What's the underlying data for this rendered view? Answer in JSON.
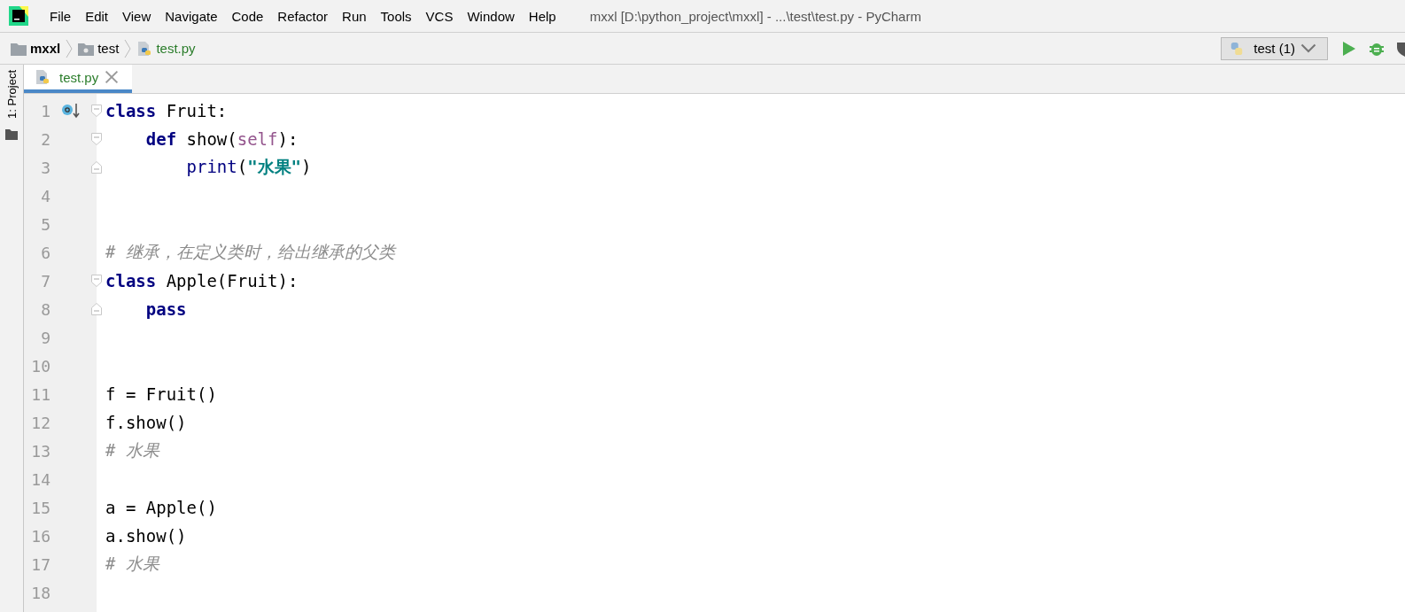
{
  "menu": [
    "File",
    "Edit",
    "View",
    "Navigate",
    "Code",
    "Refactor",
    "Run",
    "Tools",
    "VCS",
    "Window",
    "Help"
  ],
  "window": {
    "title": "mxxl [D:\\python_project\\mxxl] - ...\\test\\test.py - PyCharm"
  },
  "breadcrumbs": [
    {
      "kind": "project",
      "label": "mxxl"
    },
    {
      "kind": "folder",
      "label": "test"
    },
    {
      "kind": "file",
      "label": "test.py"
    }
  ],
  "run_config": {
    "label": "test (1)"
  },
  "side_tool": {
    "label": "1: Project"
  },
  "tabs": [
    {
      "label": "test.py",
      "selected": true
    }
  ],
  "lines": [
    {
      "number": "1",
      "override_marker": true,
      "fold_start": true,
      "tokens": [
        {
          "kind": "keyword",
          "text": "class"
        },
        {
          "kind": "plain",
          "text": " Fruit:"
        }
      ]
    },
    {
      "number": "2",
      "fold_start": true,
      "tokens": [
        {
          "kind": "keyword",
          "text": "    def"
        },
        {
          "kind": "plain",
          "text": " show("
        },
        {
          "kind": "self",
          "text": "self"
        },
        {
          "kind": "plain",
          "text": "):"
        }
      ]
    },
    {
      "number": "3",
      "fold_end": true,
      "tokens": [
        {
          "kind": "builtin",
          "text": "        print"
        },
        {
          "kind": "plain",
          "text": "("
        },
        {
          "kind": "string",
          "text": "\"水果\""
        },
        {
          "kind": "plain",
          "text": ")"
        }
      ]
    },
    {
      "number": "4"
    },
    {
      "number": "5"
    },
    {
      "number": "6",
      "tokens": [
        {
          "kind": "comment",
          "text": "# 继承，在定义类时，给出继承的父类"
        }
      ]
    },
    {
      "number": "7",
      "fold_start": true,
      "tokens": [
        {
          "kind": "keyword",
          "text": "class"
        },
        {
          "kind": "plain",
          "text": " Apple(Fruit):"
        }
      ]
    },
    {
      "number": "8",
      "fold_end": true,
      "tokens": [
        {
          "kind": "keyword",
          "text": "    pass"
        }
      ]
    },
    {
      "number": "9"
    },
    {
      "number": "10"
    },
    {
      "number": "11",
      "tokens": [
        {
          "kind": "plain",
          "text": "f = Fruit()"
        }
      ]
    },
    {
      "number": "12",
      "tokens": [
        {
          "kind": "plain",
          "text": "f.show()"
        }
      ]
    },
    {
      "number": "13",
      "tokens": [
        {
          "kind": "comment",
          "text": "# 水果"
        }
      ]
    },
    {
      "number": "14"
    },
    {
      "number": "15",
      "tokens": [
        {
          "kind": "plain",
          "text": "a = Apple()"
        }
      ]
    },
    {
      "number": "16",
      "tokens": [
        {
          "kind": "plain",
          "text": "a.show()"
        }
      ]
    },
    {
      "number": "17",
      "tokens": [
        {
          "kind": "comment",
          "text": "# 水果"
        }
      ]
    },
    {
      "number": "18"
    }
  ]
}
